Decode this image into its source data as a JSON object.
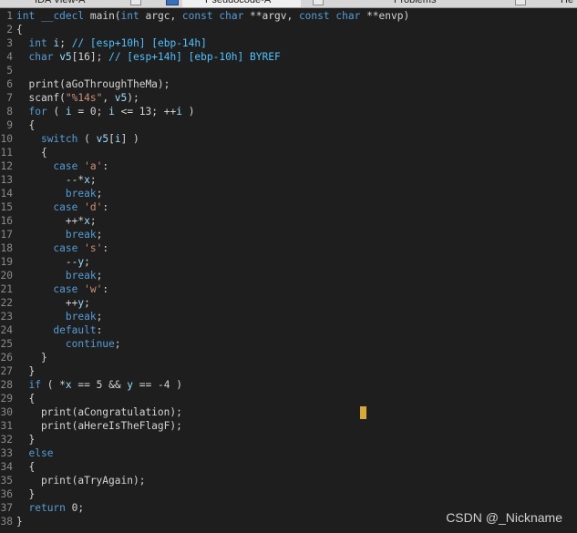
{
  "tabs": [
    {
      "label": "IDA View-A"
    },
    {
      "label": "Pseudocode-A"
    },
    {
      "label": "Problems"
    },
    {
      "label": "He"
    }
  ],
  "editor": {
    "lines": [
      {
        "n": "1",
        "text": "int __cdecl main(int argc, const char **argv, const char **envp)"
      },
      {
        "n": "2",
        "text": "{"
      },
      {
        "n": "3",
        "text": "  int i; // [esp+10h] [ebp-14h]"
      },
      {
        "n": "4",
        "text": "  char v5[16]; // [esp+14h] [ebp-10h] BYREF"
      },
      {
        "n": "5",
        "text": ""
      },
      {
        "n": "6",
        "text": "  print(aGoThroughTheMa);"
      },
      {
        "n": "7",
        "text": "  scanf(\"%14s\", v5);"
      },
      {
        "n": "8",
        "text": "  for ( i = 0; i <= 13; ++i )"
      },
      {
        "n": "9",
        "text": "  {"
      },
      {
        "n": "10",
        "text": "    switch ( v5[i] )"
      },
      {
        "n": "11",
        "text": "    {"
      },
      {
        "n": "12",
        "text": "      case 'a':"
      },
      {
        "n": "13",
        "text": "        --*x;"
      },
      {
        "n": "14",
        "text": "        break;"
      },
      {
        "n": "15",
        "text": "      case 'd':"
      },
      {
        "n": "16",
        "text": "        ++*x;"
      },
      {
        "n": "17",
        "text": "        break;"
      },
      {
        "n": "18",
        "text": "      case 's':"
      },
      {
        "n": "19",
        "text": "        --y;"
      },
      {
        "n": "20",
        "text": "        break;"
      },
      {
        "n": "21",
        "text": "      case 'w':"
      },
      {
        "n": "22",
        "text": "        ++y;"
      },
      {
        "n": "23",
        "text": "        break;"
      },
      {
        "n": "24",
        "text": "      default:"
      },
      {
        "n": "25",
        "text": "        continue;"
      },
      {
        "n": "26",
        "text": "    }"
      },
      {
        "n": "27",
        "text": "  }"
      },
      {
        "n": "28",
        "text": "  if ( *x == 5 && y == -4 )"
      },
      {
        "n": "29",
        "text": "  {"
      },
      {
        "n": "30",
        "text": "    print(aCongratulation);"
      },
      {
        "n": "31",
        "text": "    print(aHereIsTheFlagF);"
      },
      {
        "n": "32",
        "text": "  }"
      },
      {
        "n": "33",
        "text": "  else"
      },
      {
        "n": "34",
        "text": "  {"
      },
      {
        "n": "35",
        "text": "    print(aTryAgain);"
      },
      {
        "n": "36",
        "text": "  }"
      },
      {
        "n": "37",
        "text": "  return 0;"
      },
      {
        "n": "38",
        "text": "}"
      }
    ]
  },
  "watermark": "CSDN @_Nickname",
  "colors": {
    "background": "#1e1e1e",
    "keyword": "#569cd6",
    "string": "#ce9178",
    "variable": "#9cdcfe",
    "comment": "#4fc1ff",
    "text": "#d4d4d4",
    "cursor": "#d7a83a"
  }
}
